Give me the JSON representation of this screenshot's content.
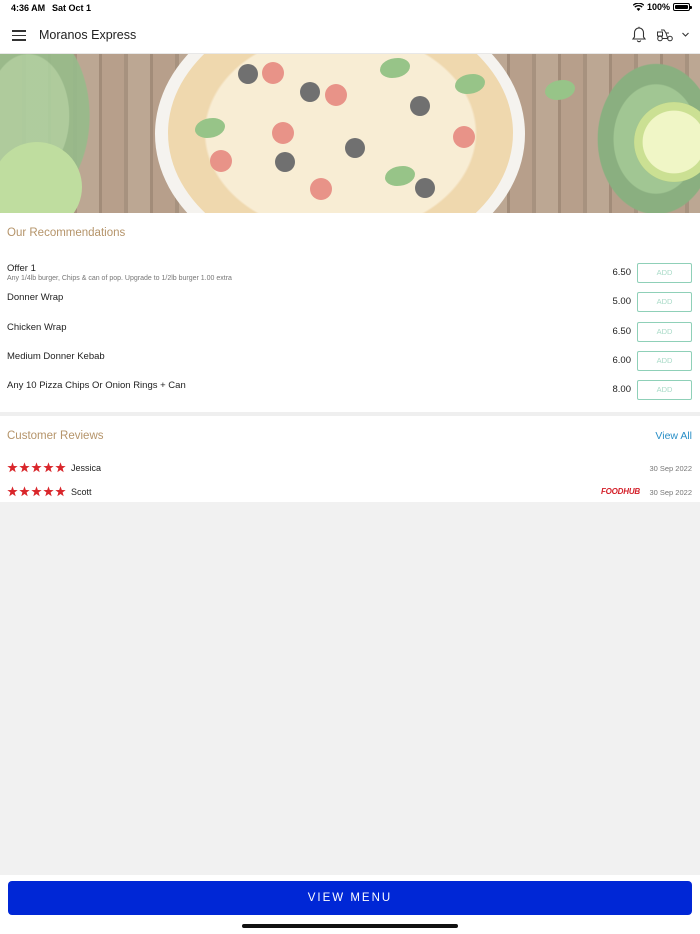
{
  "status_bar": {
    "time": "4:36 AM",
    "date": "Sat Oct 1",
    "battery": "100%"
  },
  "header": {
    "title": "Moranos Express",
    "icons": [
      "hamburger-menu-icon",
      "bell-icon",
      "delivery-scooter-icon",
      "chevron-down-icon"
    ]
  },
  "recommendations": {
    "title": "Our Recommendations",
    "add_label": "ADD",
    "items": [
      {
        "name": "Offer 1",
        "description": "Any 1/4lb burger, Chips & can of pop. Upgrade to 1/2lb burger 1.00 extra",
        "price": "6.50"
      },
      {
        "name": "Donner Wrap",
        "description": "",
        "price": "5.00"
      },
      {
        "name": "Chicken Wrap",
        "description": "",
        "price": "6.50"
      },
      {
        "name": "Medium Donner Kebab",
        "description": "",
        "price": "6.00"
      },
      {
        "name": "Any 10 Pizza Chips Or Onion Rings + Can",
        "description": "",
        "price": "8.00"
      }
    ]
  },
  "reviews": {
    "title": "Customer Reviews",
    "view_all": "View All",
    "items": [
      {
        "name": "Jessica",
        "rating": 5,
        "date": "30 Sep 2022",
        "source": ""
      },
      {
        "name": "Scott",
        "rating": 5,
        "date": "30 Sep 2022",
        "source": "FOODHUB"
      }
    ]
  },
  "footer": {
    "view_menu": "VIEW MENU"
  },
  "colors": {
    "accent_title": "#b5946a",
    "link": "#2a8fc7",
    "button": "#0027d6",
    "add_border": "#8fd0b8",
    "star": "#d9262b"
  }
}
